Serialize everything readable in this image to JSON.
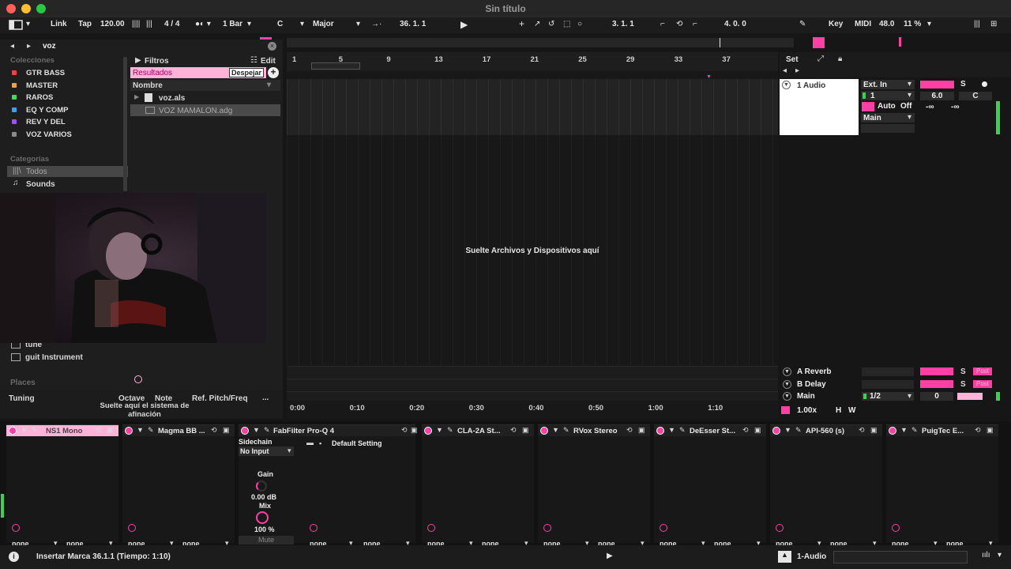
{
  "window": {
    "title": "Sin título"
  },
  "controlbar": {
    "link": "Link",
    "tap": "Tap",
    "tempo": "120.00",
    "signature": "4 / 4",
    "quantize": "1 Bar",
    "key_root": "C",
    "scale": "Major",
    "position": "36.   1.   1",
    "loop_start": "3.   1.   1",
    "loop_length": "4.   0.   0",
    "key_label": "Key",
    "midi_label": "MIDI",
    "zoom": "48.0",
    "cpu": "11 %"
  },
  "browser": {
    "search": "voz",
    "collections_header": "Colecciones",
    "collections": [
      {
        "label": "GTR BASS",
        "color": "#ff3b3b"
      },
      {
        "label": "MASTER",
        "color": "#ff9f2e"
      },
      {
        "label": "RAROS",
        "color": "#3ddc5b"
      },
      {
        "label": "EQ Y COMP",
        "color": "#3aa0ff"
      },
      {
        "label": "REV Y DEL",
        "color": "#a44dff"
      },
      {
        "label": "VOZ VARIOS",
        "color": "#8a8a8a"
      }
    ],
    "categories_header": "Categorías",
    "categories": [
      "Todos",
      "Sounds"
    ],
    "lower_items": [
      "tune",
      "guit Instrument"
    ],
    "places_header": "Places",
    "filters_label": "Filtros",
    "edit_label": "Edit",
    "results_label": "Resultados",
    "clear_label": "Despejar",
    "name_header": "Nombre",
    "results": [
      "voz.als",
      "VOZ MAMALON.adg"
    ],
    "tuning": {
      "label": "Tuning",
      "octave": "Octave",
      "note": "Note",
      "ref": "Ref. Pitch/Freq",
      "more": "...",
      "drop_hint": "Suelte aquí el sistema de afinación"
    }
  },
  "arrangement": {
    "set_label": "Set",
    "bars": [
      "1",
      "5",
      "9",
      "13",
      "17",
      "21",
      "25",
      "29",
      "33",
      "37"
    ],
    "times": [
      "0:00",
      "0:10",
      "0:20",
      "0:30",
      "0:40",
      "0:50",
      "1:00",
      "1:10"
    ],
    "drop_hint": "Suelte Archivos y Dispositivos aquí"
  },
  "mixer": {
    "track_name": "1 Audio",
    "input_type": "Ext. In",
    "input_channel": "1",
    "monitor_auto": "Auto",
    "monitor_off": "Off",
    "output": "Main",
    "volume": "6.0",
    "pan": "C",
    "send_a": "-∞",
    "send_b": "-∞",
    "solo": "S",
    "returns": [
      {
        "name": "A Reverb",
        "solo": "S",
        "post": "Post"
      },
      {
        "name": "B Delay",
        "solo": "S",
        "post": "Post"
      }
    ],
    "main_label": "Main",
    "main_ratio": "1/2",
    "main_value": "0",
    "playback_speed": "1.00x",
    "h_label": "H",
    "w_label": "W"
  },
  "devices": [
    {
      "name": "NS1 Mono",
      "sel1": "none",
      "sel2": "none"
    },
    {
      "name": "Magma BB ...",
      "sel1": "none",
      "sel2": "none"
    },
    {
      "name": "FabFilter Pro-Q 4",
      "sel1": "none",
      "sel2": "none",
      "sidechain": "Sidechain",
      "sc_input": "No Input",
      "gain_label": "Gain",
      "gain_value": "0.00 dB",
      "mix_label": "Mix",
      "mix_value": "100 %",
      "mute": "Mute",
      "preset": "Default Setting"
    },
    {
      "name": "CLA-2A St...",
      "sel1": "none",
      "sel2": "none"
    },
    {
      "name": "RVox Stereo",
      "sel1": "none",
      "sel2": "none"
    },
    {
      "name": "DeEsser St...",
      "sel1": "none",
      "sel2": "none"
    },
    {
      "name": "API-560 (s)",
      "sel1": "none",
      "sel2": "none"
    },
    {
      "name": "PuigTec E...",
      "sel1": "none",
      "sel2": "none"
    }
  ],
  "status": {
    "message": "Insertar Marca 36.1.1 (Tiempo: 1:10)",
    "track": "1-Audio"
  },
  "colors": {
    "accent": "#ff3fa4",
    "accent_light": "#ffb3d9",
    "meter": "#39d353"
  }
}
